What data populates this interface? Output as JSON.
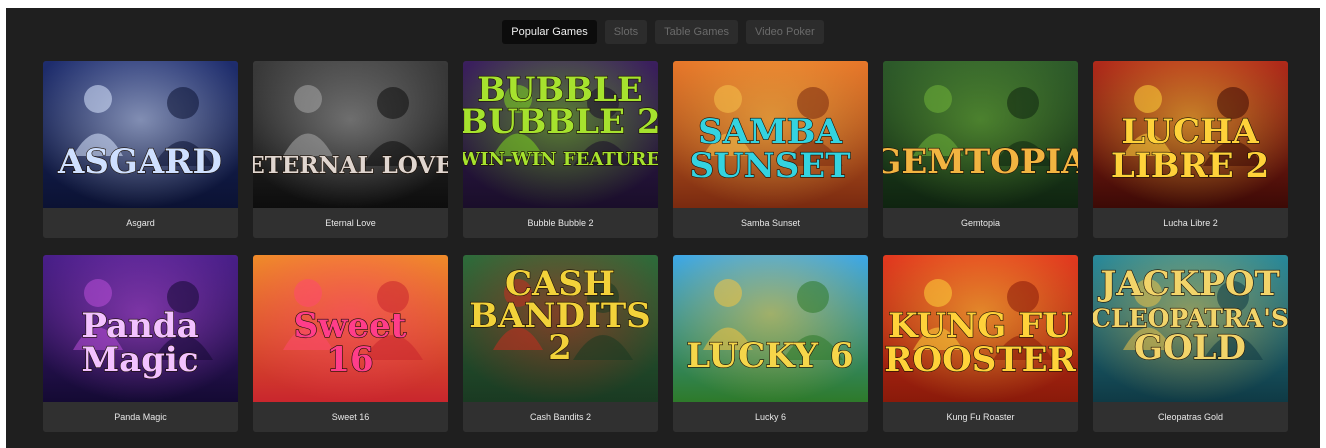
{
  "tabs": [
    {
      "label": "Popular Games",
      "active": true
    },
    {
      "label": "Slots",
      "active": false
    },
    {
      "label": "Table Games",
      "active": false
    },
    {
      "label": "Video Poker",
      "active": false
    }
  ],
  "games": [
    {
      "title": "Asgard",
      "art_text": [
        "ASGARD"
      ],
      "colors": {
        "top": "#1e2d6e",
        "bottom": "#0b1233",
        "accent": "#d9e6ff",
        "text": "#cfe0ff"
      }
    },
    {
      "title": "Eternal Love",
      "art_text": [
        "ETERNAL LOVE"
      ],
      "colors": {
        "top": "#3a3a3a",
        "bottom": "#0d0d0d",
        "accent": "#a8a8a8",
        "text": "#e0d6d0"
      }
    },
    {
      "title": "Bubble Bubble 2",
      "art_text": [
        "BUBBLE",
        "BUBBLE 2",
        "WIN-WIN FEATURE"
      ],
      "colors": {
        "top": "#3b1f5e",
        "bottom": "#1a0e2a",
        "accent": "#7ed321",
        "text": "#a6e22e"
      }
    },
    {
      "title": "Samba Sunset",
      "art_text": [
        "SAMBA",
        "SUNSET"
      ],
      "colors": {
        "top": "#e8782a",
        "bottom": "#7a2a10",
        "accent": "#f6c14b",
        "text": "#34d3e0"
      }
    },
    {
      "title": "Gemtopia",
      "art_text": [
        "GEMTOPIA"
      ],
      "colors": {
        "top": "#2d5a2a",
        "bottom": "#0f2410",
        "accent": "#6fb33a",
        "text": "#f2b441"
      }
    },
    {
      "title": "Lucha Libre 2",
      "art_text": [
        "LUCHA",
        "LIBRE 2"
      ],
      "colors": {
        "top": "#b12a1a",
        "bottom": "#3c0a06",
        "accent": "#ffd23a",
        "text": "#ffd23a"
      }
    },
    {
      "title": "Panda Magic",
      "art_text": [
        "Panda",
        "Magic"
      ],
      "colors": {
        "top": "#4a1f8a",
        "bottom": "#140a33",
        "accent": "#b84ed8",
        "text": "#f3c2ff"
      }
    },
    {
      "title": "Sweet 16",
      "art_text": [
        "Sweet",
        "16"
      ],
      "colors": {
        "top": "#f08a2a",
        "bottom": "#c9262d",
        "accent": "#ff4a6e",
        "text": "#ff3d8a"
      }
    },
    {
      "title": "Cash Bandits 2",
      "art_text": [
        "CASH",
        "BANDITS",
        "2"
      ],
      "colors": {
        "top": "#2f6b3a",
        "bottom": "#1a3a22",
        "accent": "#c62e1f",
        "text": "#f2d23a"
      }
    },
    {
      "title": "Lucky 6",
      "art_text": [
        "LUCKY 6"
      ],
      "colors": {
        "top": "#3fa8e6",
        "bottom": "#2e7a2a",
        "accent": "#f5c542",
        "text": "#f5d64a"
      }
    },
    {
      "title": "Kung Fu Roaster",
      "art_text": [
        "KUNG FU",
        "ROOSTER"
      ],
      "colors": {
        "top": "#e33a1f",
        "bottom": "#8a1a0a",
        "accent": "#ffd23a",
        "text": "#ffd23a"
      }
    },
    {
      "title": "Cleopatras Gold",
      "art_text": [
        "JACKPOT",
        "CLEOPATRA'S",
        "GOLD"
      ],
      "colors": {
        "top": "#2a8a9a",
        "bottom": "#0f3a45",
        "accent": "#e6c04a",
        "text": "#f2d46a"
      }
    }
  ]
}
